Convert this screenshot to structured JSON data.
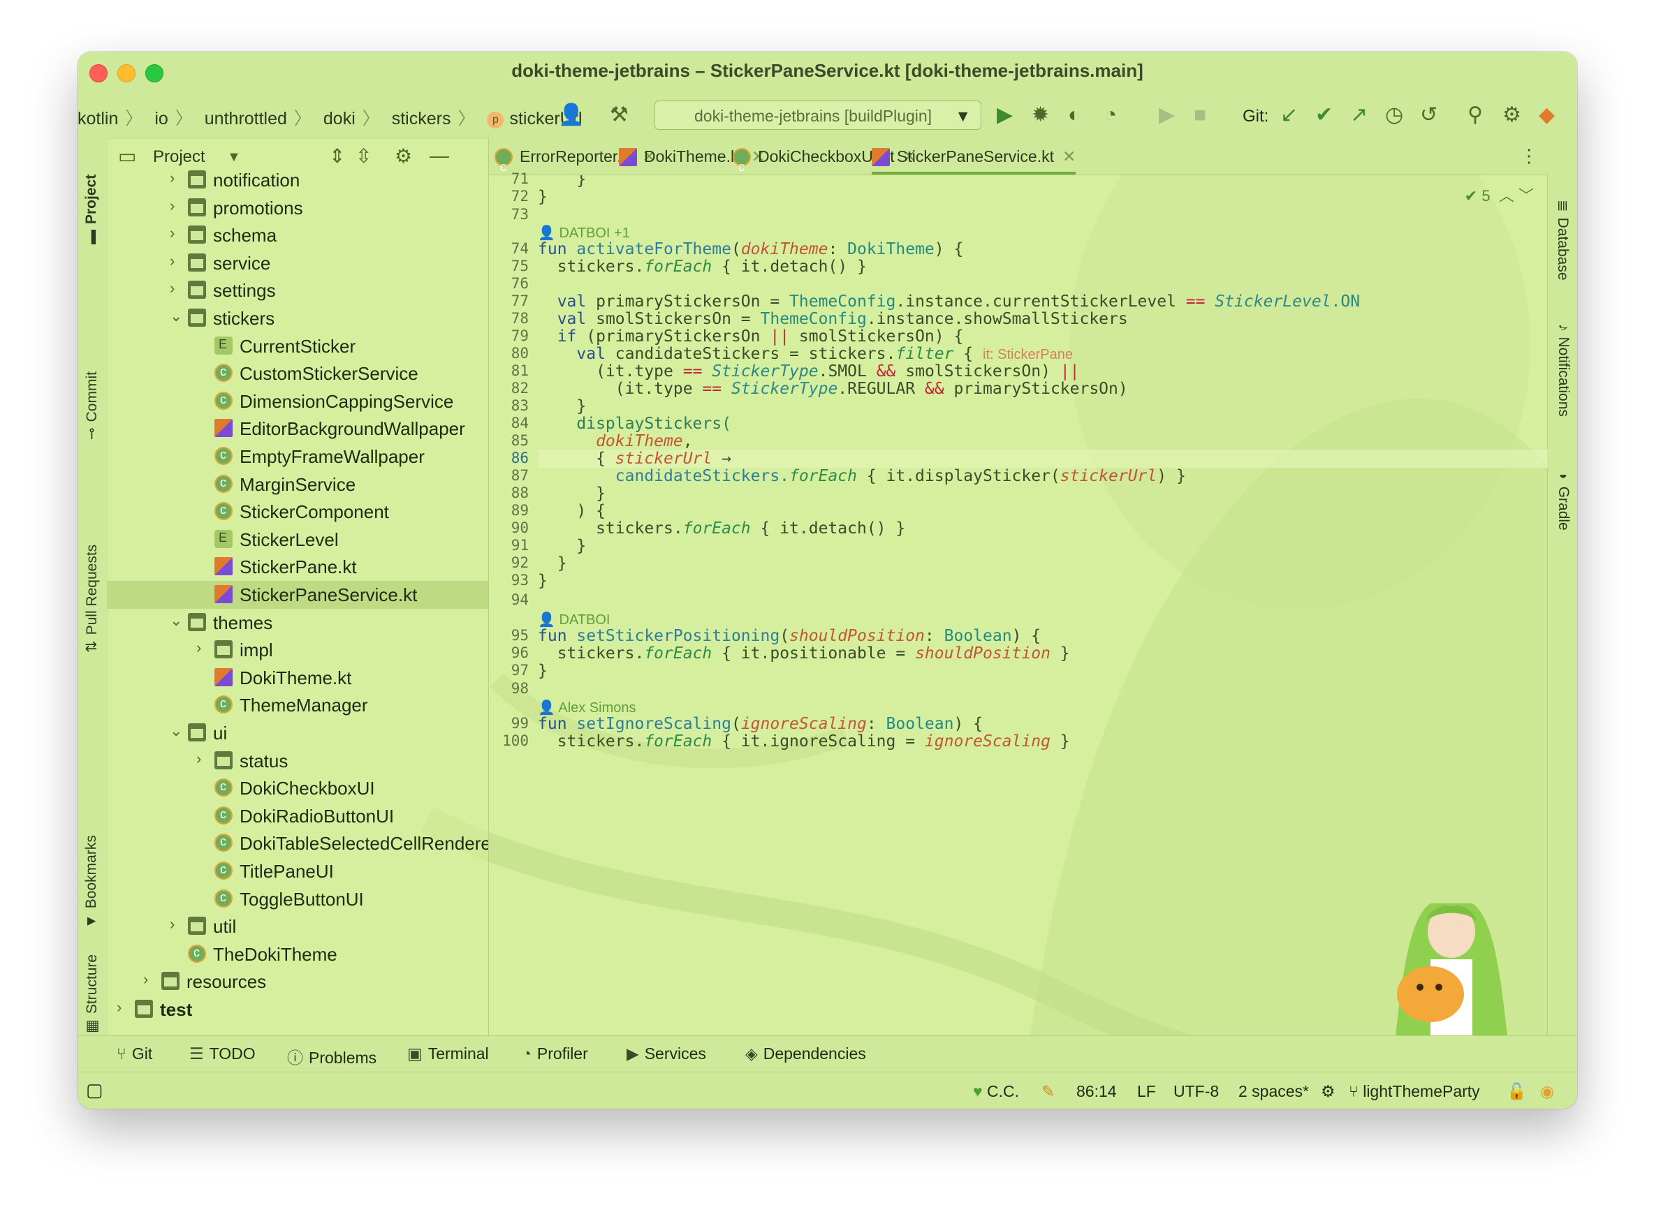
{
  "window": {
    "title": "doki-theme-jetbrains – StickerPaneService.kt [doki-theme-jetbrains.main]"
  },
  "breadcrumb": [
    "kotlin",
    "io",
    "unthrottled",
    "doki",
    "stickers",
    "stickerUrl"
  ],
  "breadcrumb_badge": "p",
  "run_config": {
    "label": "doki-theme-jetbrains [buildPlugin]"
  },
  "toolbar": {
    "git_label": "Git:"
  },
  "left_tabs": [
    "Project",
    "Commit",
    "Pull Requests",
    "Bookmarks",
    "Structure"
  ],
  "right_tabs": [
    "Database",
    "Notifications",
    "Gradle"
  ],
  "project_panel": {
    "title": "Project"
  },
  "tree": [
    {
      "label": "notification",
      "type": "folder",
      "depth": 2,
      "expanded": false
    },
    {
      "label": "promotions",
      "type": "folder",
      "depth": 2,
      "expanded": false
    },
    {
      "label": "schema",
      "type": "folder",
      "depth": 2,
      "expanded": false
    },
    {
      "label": "service",
      "type": "folder",
      "depth": 2,
      "expanded": false
    },
    {
      "label": "settings",
      "type": "folder",
      "depth": 2,
      "expanded": false
    },
    {
      "label": "stickers",
      "type": "folder",
      "depth": 2,
      "expanded": true
    },
    {
      "label": "CurrentSticker",
      "type": "enum",
      "depth": 3
    },
    {
      "label": "CustomStickerService",
      "type": "class",
      "depth": 3
    },
    {
      "label": "DimensionCappingService",
      "type": "class",
      "depth": 3
    },
    {
      "label": "EditorBackgroundWallpaper",
      "type": "kt",
      "depth": 3
    },
    {
      "label": "EmptyFrameWallpaper",
      "type": "class",
      "depth": 3
    },
    {
      "label": "MarginService",
      "type": "class",
      "depth": 3
    },
    {
      "label": "StickerComponent",
      "type": "class",
      "depth": 3
    },
    {
      "label": "StickerLevel",
      "type": "enum",
      "depth": 3
    },
    {
      "label": "StickerPane.kt",
      "type": "kt",
      "depth": 3
    },
    {
      "label": "StickerPaneService.kt",
      "type": "kt",
      "depth": 3,
      "selected": true
    },
    {
      "label": "themes",
      "type": "folder",
      "depth": 2,
      "expanded": true
    },
    {
      "label": "impl",
      "type": "folder",
      "depth": 3,
      "expanded": false
    },
    {
      "label": "DokiTheme.kt",
      "type": "kt",
      "depth": 3
    },
    {
      "label": "ThemeManager",
      "type": "class",
      "depth": 3
    },
    {
      "label": "ui",
      "type": "folder",
      "depth": 2,
      "expanded": true
    },
    {
      "label": "status",
      "type": "folder",
      "depth": 3,
      "expanded": false
    },
    {
      "label": "DokiCheckboxUI",
      "type": "class",
      "depth": 3
    },
    {
      "label": "DokiRadioButtonUI",
      "type": "class",
      "depth": 3
    },
    {
      "label": "DokiTableSelectedCellRenderer",
      "type": "class",
      "depth": 3
    },
    {
      "label": "TitlePaneUI",
      "type": "class",
      "depth": 3
    },
    {
      "label": "ToggleButtonUI",
      "type": "class",
      "depth": 3
    },
    {
      "label": "util",
      "type": "folder",
      "depth": 2,
      "expanded": false
    },
    {
      "label": "TheDokiTheme",
      "type": "class",
      "depth": 2
    },
    {
      "label": "resources",
      "type": "folder",
      "depth": 1,
      "expanded": false
    },
    {
      "label": "test",
      "type": "folder",
      "depth": 0,
      "expanded": false,
      "bold": true
    }
  ],
  "editor_tabs": [
    {
      "label": "ErrorReporter.kt",
      "icon": "class",
      "active": false
    },
    {
      "label": "DokiTheme.kt",
      "icon": "kt",
      "active": false
    },
    {
      "label": "DokiCheckboxUI.kt",
      "icon": "class",
      "active": false
    },
    {
      "label": "StickerPaneService.kt",
      "icon": "kt",
      "active": true
    }
  ],
  "inspections": {
    "count": "5"
  },
  "line_numbers": [
    "71",
    "72",
    "73",
    "74",
    "75",
    "76",
    "77",
    "78",
    "79",
    "80",
    "81",
    "82",
    "83",
    "84",
    "85",
    "86",
    "87",
    "88",
    "89",
    "90",
    "91",
    "92",
    "93",
    "94",
    "95",
    "96",
    "97",
    "98",
    "99",
    "100"
  ],
  "current_line": "86",
  "authors": {
    "a1": "DATBOI +1",
    "a2": "DATBOI",
    "a3": "Alex Simons"
  },
  "code": {
    "l71": "  }",
    "l72": "}",
    "l74_kw": "fun ",
    "l74_fn": "activateForTheme",
    "l74_p": "dokiTheme",
    "l74_t": "DokiTheme",
    "l74_end": ") {",
    "l75": "  stickers.",
    "l75_i": "forEach",
    "l75_end": " { it.detach() }",
    "l77_kw": "  val ",
    "l77_a": "primaryStickersOn = ",
    "l77_t": "ThemeConfig",
    "l77_b": ".instance.currentStickerLevel ",
    "l77_op": "==",
    "l77_e": "StickerLevel",
    "l77_c": ".ON",
    "l78_kw": "  val ",
    "l78_a": "smolStickersOn = ",
    "l78_t": "ThemeConfig",
    "l78_b": ".instance.showSmallStickers",
    "l79_kw": "  if ",
    "l79_a": "(primaryStickersOn ",
    "l79_op": "||",
    "l79_b": " smolStickersOn) {",
    "l80_kw": "    val ",
    "l80_a": "candidateStickers = stickers.",
    "l80_i": "filter",
    "l80_b": " { ",
    "l80_hint": "it: StickerPane",
    "l81_a": "      (it.type ",
    "l81_op": "==",
    "l81_e": "StickerType",
    "l81_b": ".SMOL ",
    "l81_op2": "&&",
    "l81_c": " smolStickersOn) ",
    "l81_op3": "||",
    "l82_a": "        (it.type ",
    "l82_op": "==",
    "l82_e": "StickerType",
    "l82_b": ".REGULAR ",
    "l82_op2": "&&",
    "l82_c": " primaryStickersOn)",
    "l83": "    }",
    "l84": "    displayStickers(",
    "l85_p": "      dokiTheme",
    "l85_end": ",",
    "l86_a": "      { ",
    "l86_p": "stickerUrl",
    "l86_b": " →",
    "l87_a": "        candidateStickers.",
    "l87_i": "forEach",
    "l87_b": " { it.displaySticker(",
    "l87_p": "stickerUrl",
    "l87_c": ") }",
    "l88": "      }",
    "l89": "    ) {",
    "l90_a": "      stickers.",
    "l90_i": "forEach",
    "l90_b": " { it.detach() }",
    "l91": "    }",
    "l92": "  }",
    "l93": "}",
    "l95_kw": "fun ",
    "l95_fn": "setStickerPositioning",
    "l95_p": "shouldPosition",
    "l95_t": "Boolean",
    "l95_end": ") {",
    "l96_a": "  stickers.",
    "l96_i": "forEach",
    "l96_b": " { it.positionable = ",
    "l96_p": "shouldPosition",
    "l96_c": " }",
    "l97": "}",
    "l99_kw": "fun ",
    "l99_fn": "setIgnoreScaling",
    "l99_p": "ignoreScaling",
    "l99_t": "Boolean",
    "l99_end": ") {",
    "l100_a": "  stickers.",
    "l100_i": "forEach",
    "l100_b": " { it.ignoreScaling = ",
    "l100_p": "ignoreScaling",
    "l100_c": " }"
  },
  "bottom_tabs": [
    "Git",
    "TODO",
    "Problems",
    "Terminal",
    "Profiler",
    "Services",
    "Dependencies"
  ],
  "status": {
    "theme": "C.C.",
    "position": "86:14",
    "line_sep": "LF",
    "encoding": "UTF-8",
    "indent": "2 spaces*",
    "branch": "lightThemeParty"
  },
  "colors": {
    "accent": "#6fae3f",
    "background": "#d6ef9e",
    "keyword": "#28508b"
  }
}
